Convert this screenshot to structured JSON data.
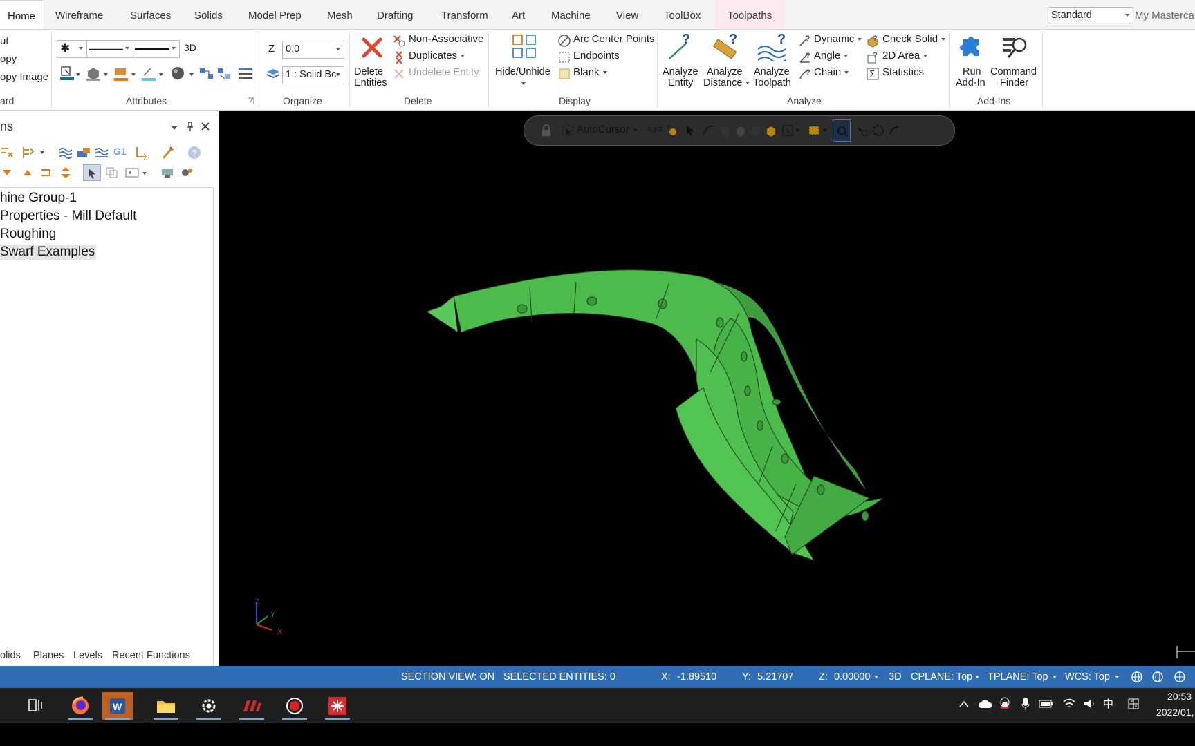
{
  "tabs": [
    "Home",
    "Wireframe",
    "Surfaces",
    "Solids",
    "Model Prep",
    "Mesh",
    "Drafting",
    "Transform",
    "Art",
    "Machine",
    "View",
    "ToolBox",
    "Toolpaths"
  ],
  "active_tab": "Home",
  "contextual_tab": "Toolpaths",
  "topright": {
    "dropdown_value": "Standard",
    "my_mastercam": "My Mastercam"
  },
  "clipboard": {
    "items": [
      "ut",
      "opy",
      "opy Image"
    ],
    "label": "ard"
  },
  "attributes": {
    "dim_label": "3D",
    "label": "Attributes"
  },
  "organize": {
    "z_label": "Z",
    "z_value": "0.0",
    "level_value": "1 : Solid Bc",
    "label": "Organize"
  },
  "delete": {
    "big_label_1": "Delete",
    "big_label_2": "Entities",
    "non_associative": "Non-Associative",
    "duplicates": "Duplicates",
    "undelete": "Undelete Entity",
    "label": "Delete"
  },
  "display": {
    "hide_unhide": "Hide/Unhide",
    "arc_center_points": "Arc Center Points",
    "endpoints": "Endpoints",
    "blank": "Blank",
    "label": "Display"
  },
  "analyze": {
    "entity_1": "Analyze",
    "entity_2": "Entity",
    "distance_1": "Analyze",
    "distance_2": "Distance",
    "toolpath_1": "Analyze",
    "toolpath_2": "Toolpath",
    "dynamic": "Dynamic",
    "angle": "Angle",
    "chain": "Chain",
    "check_solid": "Check Solid",
    "area_2d": "2D Area",
    "statistics": "Statistics",
    "label": "Analyze"
  },
  "addins": {
    "run_1": "Run",
    "run_2": "Add-In",
    "finder_1": "Command",
    "finder_2": "Finder",
    "label": "Add-Ins"
  },
  "panel": {
    "title": "ns",
    "tree": [
      "hine Group-1",
      "Properties - Mill Default",
      "Roughing",
      "Swarf Examples"
    ],
    "selected_index": 3,
    "bottom_tabs": [
      "olids",
      "Planes",
      "Levels",
      "Recent Functions"
    ]
  },
  "viewport": {
    "autocursor": "AutoCursor",
    "axes": {
      "z": "Z",
      "y": "Y",
      "x": "X"
    },
    "model_color": "#4cbb4c"
  },
  "status": {
    "section_view": "SECTION VIEW: ON",
    "selected": "SELECTED ENTITIES: 0",
    "x_label": "X:",
    "x_value": "-1.89510",
    "y_label": "Y:",
    "y_value": "5.21707",
    "z_label": "Z:",
    "z_value": "0.00000",
    "mode": "3D",
    "cplane": "CPLANE: Top",
    "tplane": "TPLANE: Top",
    "wcs": "WCS: Top"
  },
  "taskbar": {
    "time": "20:53",
    "date": "2022/01,",
    "ime": "中"
  }
}
